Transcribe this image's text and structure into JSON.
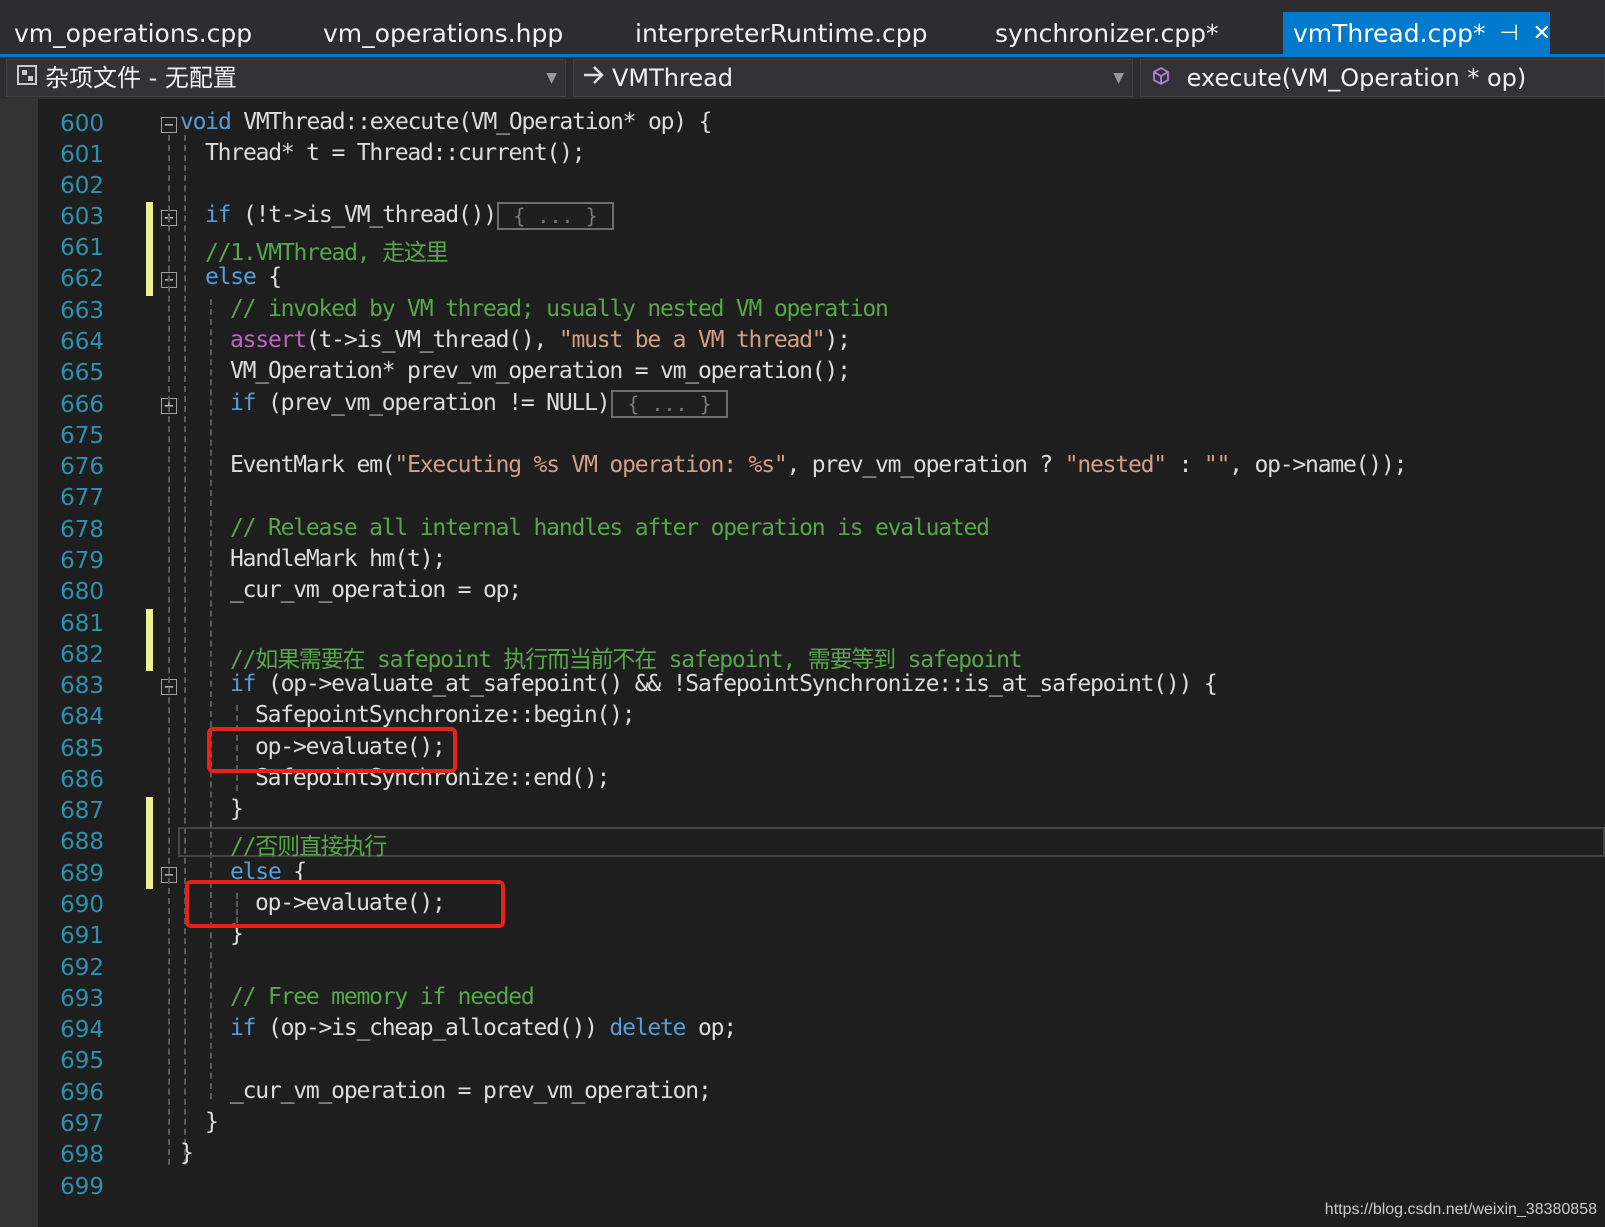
{
  "tabs": [
    {
      "label": "vm_operations.cpp"
    },
    {
      "label": "vm_operations.hpp"
    },
    {
      "label": "interpreterRuntime.cpp"
    },
    {
      "label": "synchronizer.cpp*"
    },
    {
      "label": "vmThread.cpp*",
      "pin_glyph": "⊣",
      "close_glyph": "✕"
    }
  ],
  "navbar": {
    "project": "杂项文件 - 无配置",
    "project_icon": "misc-files-icon",
    "scope": "VMThread",
    "scope_icon": "arrow-right-icon",
    "member": "execute(VM_Operation * op)",
    "member_icon": "method-cube-icon"
  },
  "line_numbers": [
    "600",
    "601",
    "602",
    "603",
    "661",
    "662",
    "663",
    "664",
    "665",
    "666",
    "675",
    "676",
    "677",
    "678",
    "679",
    "680",
    "681",
    "682",
    "683",
    "684",
    "685",
    "686",
    "687",
    "688",
    "689",
    "690",
    "691",
    "692",
    "693",
    "694",
    "695",
    "696",
    "697",
    "698",
    "699"
  ],
  "code": {
    "l600": {
      "kw": "void",
      "rest": " VMThread::execute(VM_Operation* op) {"
    },
    "l601": "Thread* t = Thread::current();",
    "l603": {
      "kw": "if",
      "rest": " (!t->is_VM_thread())",
      "collapsed": "{ ... }"
    },
    "l661": "//1.VMThread, 走这里",
    "l662": {
      "kw": "else",
      "rest": " {"
    },
    "l663": "// invoked by VM thread; usually nested VM operation",
    "l664": {
      "macro": "assert",
      "a": "(t->is_VM_thread(), ",
      "str": "\"must be a VM thread\"",
      "b": ");"
    },
    "l665": "VM_Operation* prev_vm_operation = vm_operation();",
    "l666": {
      "kw": "if",
      "rest": " (prev_vm_operation != NULL)",
      "collapsed": "{ ... }"
    },
    "l676": {
      "a": "EventMark em(",
      "str": "\"Executing %s VM operation: %s\"",
      "b": ", prev_vm_operation ? ",
      "str2": "\"nested\"",
      "c": " : ",
      "str3": "\"\"",
      "d": ", op->name());"
    },
    "l678": "// Release all internal handles after operation is evaluated",
    "l679": "HandleMark hm(t);",
    "l680": "_cur_vm_operation = op;",
    "l682": "//如果需要在 safepoint 执行而当前不在 safepoint, 需要等到 safepoint",
    "l683": {
      "kw": "if",
      "rest": " (op->evaluate_at_safepoint() && !SafepointSynchronize::is_at_safepoint()) {"
    },
    "l684": "SafepointSynchronize::begin();",
    "l685": "op->evaluate();",
    "l686": "SafepointSynchronize::end();",
    "l687": "}",
    "l688": "//否则直接执行",
    "l689": {
      "kw": "else",
      "rest": " {"
    },
    "l690": "op->evaluate();",
    "l691": "}",
    "l693": "// Free memory if needed",
    "l694": {
      "kw": "if",
      "rest": " (op->is_cheap_allocated()) ",
      "kw2": "delete",
      "rest2": " op;"
    },
    "l696": "_cur_vm_operation = prev_vm_operation;",
    "l697": "}",
    "l698": "}"
  },
  "fold_glyphs": {
    "collapse": "−",
    "expand": "+"
  },
  "watermark": "https://blog.csdn.net/weixin_38380858",
  "colors": {
    "accent": "#007acc",
    "keyword": "#569cd6",
    "comment": "#57a64a",
    "string": "#d69d85",
    "line_number": "#2b91af",
    "highlight_box": "#e8221a"
  }
}
